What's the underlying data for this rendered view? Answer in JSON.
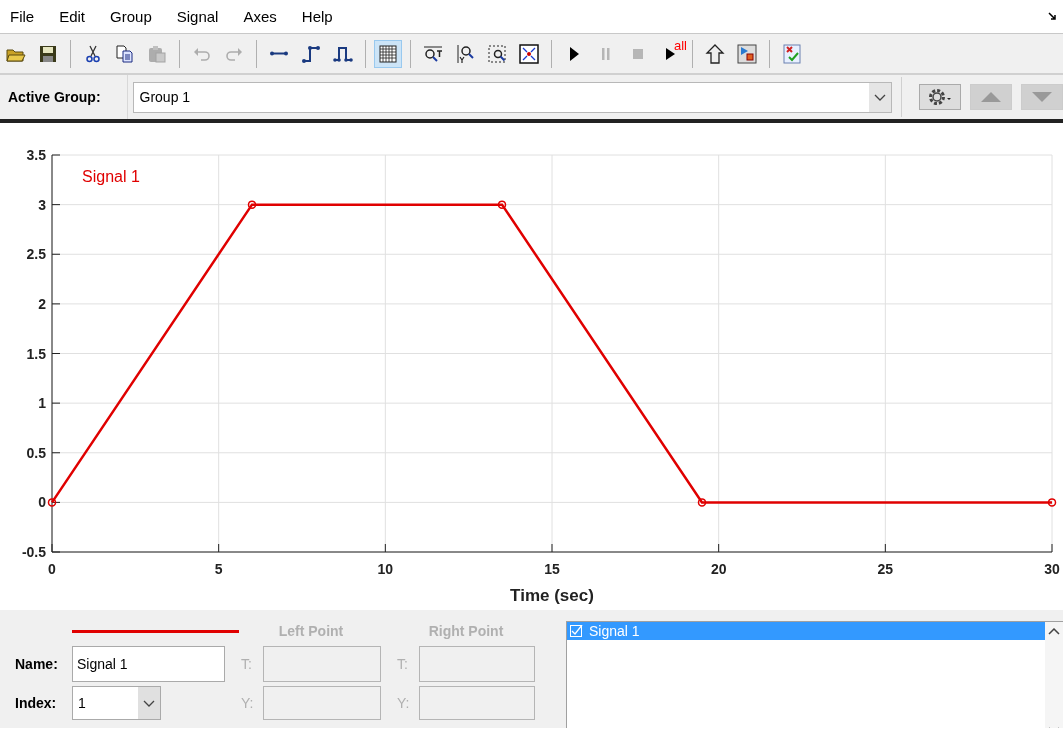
{
  "menu": [
    "File",
    "Edit",
    "Group",
    "Signal",
    "Axes",
    "Help"
  ],
  "toolbar": {
    "groups": [
      {
        "items": [
          {
            "disabled": false,
            "pressed": false
          },
          {
            "disabled": false,
            "pressed": false
          }
        ]
      },
      {
        "items": [
          {
            "disabled": false,
            "pressed": false
          },
          {
            "disabled": false,
            "pressed": false
          },
          {
            "disabled": true,
            "pressed": false
          }
        ]
      },
      {
        "items": [
          {
            "disabled": true,
            "pressed": false
          },
          {
            "disabled": true,
            "pressed": false
          }
        ]
      },
      {
        "items": [
          {
            "disabled": false,
            "pressed": false
          },
          {
            "disabled": false,
            "pressed": false
          },
          {
            "disabled": false,
            "pressed": false
          }
        ]
      },
      {
        "items": [
          {
            "disabled": false,
            "pressed": true
          }
        ]
      },
      {
        "items": [
          {
            "disabled": false,
            "pressed": false
          },
          {
            "disabled": false,
            "pressed": false
          },
          {
            "disabled": false,
            "pressed": false
          },
          {
            "disabled": false,
            "pressed": false
          }
        ]
      },
      {
        "items": [
          {
            "disabled": false,
            "pressed": false
          },
          {
            "disabled": true,
            "pressed": false
          },
          {
            "disabled": true,
            "pressed": false
          },
          {
            "disabled": false,
            "pressed": false,
            "badge": "all"
          }
        ]
      },
      {
        "items": [
          {
            "disabled": false,
            "pressed": false
          },
          {
            "disabled": false,
            "pressed": false
          }
        ]
      },
      {
        "items": [
          {
            "disabled": false,
            "pressed": false
          }
        ]
      }
    ]
  },
  "active_group": {
    "label": "Active Group:",
    "value": "Group 1",
    "buttons": [
      {
        "disabled": false
      },
      {
        "disabled": true
      },
      {
        "disabled": true
      }
    ]
  },
  "chart_data": {
    "type": "line",
    "xlabel": "Time (sec)",
    "x": [
      0,
      6,
      13.5,
      19.5,
      30
    ],
    "series": [
      {
        "name": "Signal 1",
        "color": "#e00000",
        "marker": "o",
        "values": [
          0,
          3,
          3,
          0,
          0
        ]
      }
    ],
    "grid": true,
    "xlim": [
      0,
      30
    ],
    "ylim": [
      -0.5,
      3.5
    ],
    "xticks": [
      0,
      5,
      10,
      15,
      20,
      25,
      30
    ],
    "yticks": [
      -0.5,
      0,
      0.5,
      1,
      1.5,
      2,
      2.5,
      3,
      3.5
    ]
  },
  "signal_editor": {
    "name_label": "Name:",
    "name_value": "Signal 1",
    "index_label": "Index:",
    "index_value": "1",
    "left_point": {
      "title": "Left Point",
      "t_label": "T:",
      "y_label": "Y:",
      "disabled": true
    },
    "right_point": {
      "title": "Right Point",
      "t_label": "T:",
      "y_label": "Y:",
      "disabled": true
    }
  },
  "signal_list": {
    "items": [
      {
        "label": "Signal 1",
        "checked": true,
        "selected": true
      }
    ]
  }
}
